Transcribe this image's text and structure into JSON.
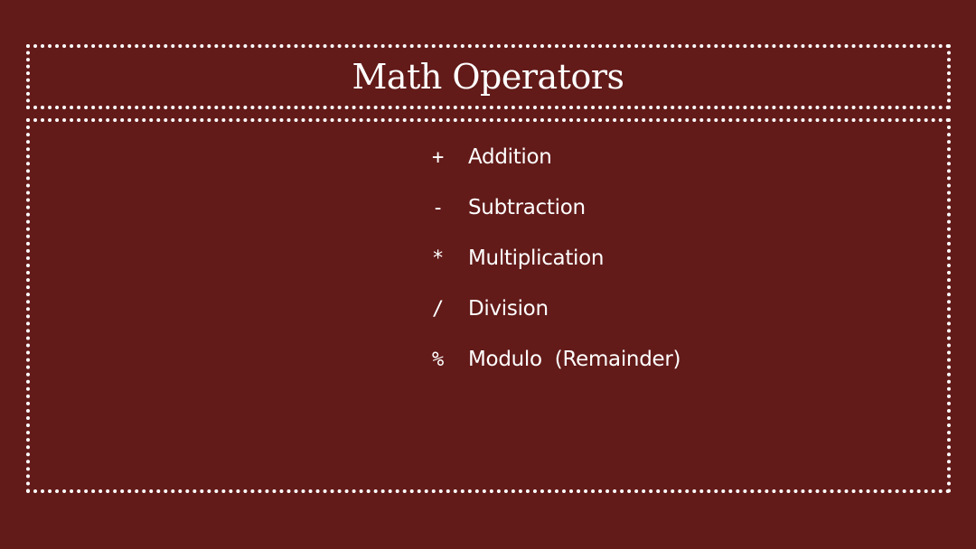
{
  "title": "Math Operators",
  "operators": [
    {
      "symbol": "+",
      "label": "Addition"
    },
    {
      "symbol": "-",
      "label": "Subtraction"
    },
    {
      "symbol": "*",
      "label": "Multiplication"
    },
    {
      "symbol": "/",
      "label": "Division"
    },
    {
      "symbol": "%",
      "label": "Modulo  (Remainder)"
    }
  ],
  "colors": {
    "background": "#621b19",
    "text": "#ffffff",
    "frame": "#ffffff"
  }
}
